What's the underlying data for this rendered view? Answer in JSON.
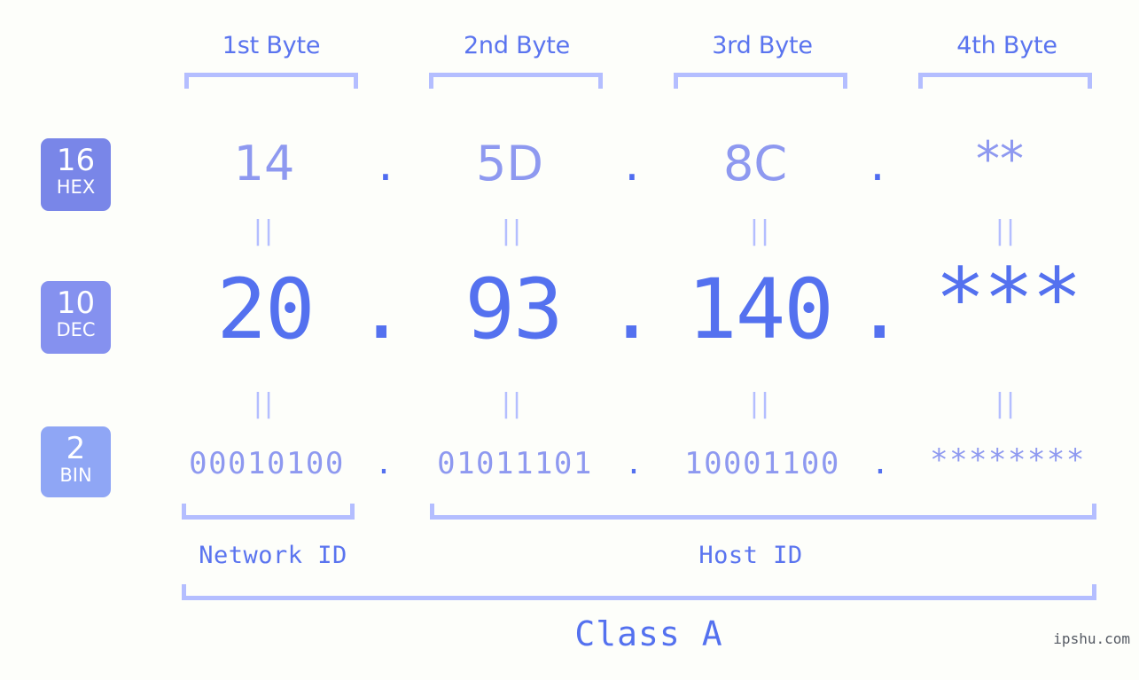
{
  "background_color": "#fdfefa",
  "accent_colors": {
    "header_text": "#5a74ef",
    "bracket": "#b4beff",
    "hex_value": "#8e99f0",
    "dec_value": "#5471ef",
    "bin_value": "#8e99f0",
    "dot": "#4f6cf0",
    "badge_hex": "#7986e8",
    "badge_dec": "#8591ef",
    "badge_bin": "#8fa6f5",
    "watermark": "#555a63"
  },
  "byte_headers": [
    {
      "label": "1st Byte"
    },
    {
      "label": "2nd Byte"
    },
    {
      "label": "3rd Byte"
    },
    {
      "label": "4th Byte"
    }
  ],
  "rows": [
    {
      "id": "hex",
      "badge": {
        "number": "16",
        "system": "HEX"
      },
      "values": [
        "14",
        "5D",
        "8C",
        "**"
      ],
      "separator": "."
    },
    {
      "id": "dec",
      "badge": {
        "number": "10",
        "system": "DEC"
      },
      "values": [
        "20",
        "93",
        "140",
        "***"
      ],
      "separator": "."
    },
    {
      "id": "bin",
      "badge": {
        "number": "2",
        "system": "BIN"
      },
      "values": [
        "00010100",
        "01011101",
        "10001100",
        "********"
      ],
      "separator": "."
    }
  ],
  "equality_marks": {
    "glyph": "||",
    "count_per_row": 4
  },
  "id_sections": [
    {
      "label": "Network ID"
    },
    {
      "label": "Host ID"
    }
  ],
  "class_label": "Class A",
  "watermark": "ipshu.com"
}
